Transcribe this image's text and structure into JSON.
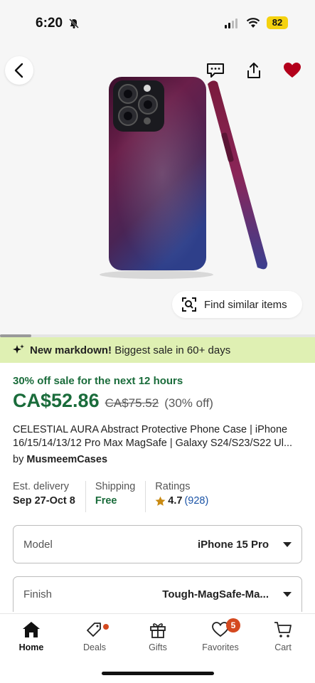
{
  "status_bar": {
    "time": "6:20",
    "battery": "82"
  },
  "hero": {
    "find_similar_label": "Find similar items",
    "icons": [
      "back-chevron-icon",
      "message-icon",
      "share-icon",
      "heart-icon"
    ],
    "favorite_color": "#b3001b"
  },
  "banner": {
    "bold": "New markdown!",
    "text": "Biggest sale in 60+ days",
    "color": "#dff0b3"
  },
  "product": {
    "sale_note": "30% off sale for the next 12 hours",
    "price": "CA$52.86",
    "original_price": "CA$75.52",
    "discount": "(30% off)",
    "title_line1": "CELESTIAL AURA Abstract Protective Phone Case | iPhone",
    "title_line2": "16/15/14/13/12 Pro Max MagSafe | Galaxy S24/S23/S22 Ul...",
    "by_prefix": "by",
    "shop": "MusmeemCases",
    "accent_color": "#1a6c3b"
  },
  "facts": {
    "delivery_label": "Est. delivery",
    "delivery_value": "Sep 27-Oct 8",
    "shipping_label": "Shipping",
    "shipping_value": "Free",
    "ratings_label": "Ratings",
    "rating_value": "4.7",
    "rating_count": "(928)"
  },
  "options": {
    "model_label": "Model",
    "model_value": "iPhone 15 Pro",
    "finish_label": "Finish",
    "finish_value": "Tough-MagSafe-Ma..."
  },
  "tabbar": {
    "home": "Home",
    "deals": "Deals",
    "gifts": "Gifts",
    "favorites": "Favorites",
    "favorites_badge": "5",
    "cart": "Cart"
  }
}
